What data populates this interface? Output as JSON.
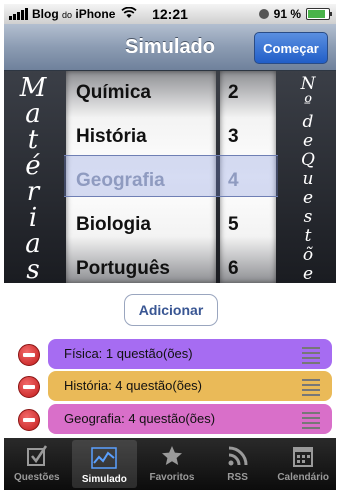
{
  "status_bar": {
    "carrier_prefix": "Blog",
    "carrier_mid": "do",
    "carrier_suffix": "iPhone",
    "time": "12:21",
    "battery": "91 %",
    "battery_level": 0.91
  },
  "nav": {
    "title": "Simulado",
    "start_button": "Começar"
  },
  "picker": {
    "left_label": [
      "M",
      "a",
      "t",
      "é",
      "r",
      "i",
      "a",
      "s"
    ],
    "right_label": [
      "N",
      "º",
      "d",
      "e",
      "Q",
      "u",
      "e",
      "s",
      "t",
      "õ",
      "e",
      "s"
    ],
    "subjects": [
      "Química",
      "História",
      "Geografia",
      "Biologia",
      "Português"
    ],
    "numbers": [
      "2",
      "3",
      "4",
      "5",
      "6"
    ],
    "selected_index": 2
  },
  "add_button": "Adicionar",
  "list": [
    {
      "label": "Física: 1 questão(ões)",
      "color": "#a66cf2"
    },
    {
      "label": "História: 4 questão(ões)",
      "color": "#eaba58"
    },
    {
      "label": "Geografia: 4 questão(ões)",
      "color": "#d96fc9"
    }
  ],
  "tabs": [
    {
      "label": "Questões",
      "icon": "checkbox-icon"
    },
    {
      "label": "Simulado",
      "icon": "chart-icon"
    },
    {
      "label": "Favoritos",
      "icon": "star-icon"
    },
    {
      "label": "RSS",
      "icon": "rss-icon"
    },
    {
      "label": "Calendário",
      "icon": "calendar-icon"
    }
  ],
  "active_tab": 1
}
